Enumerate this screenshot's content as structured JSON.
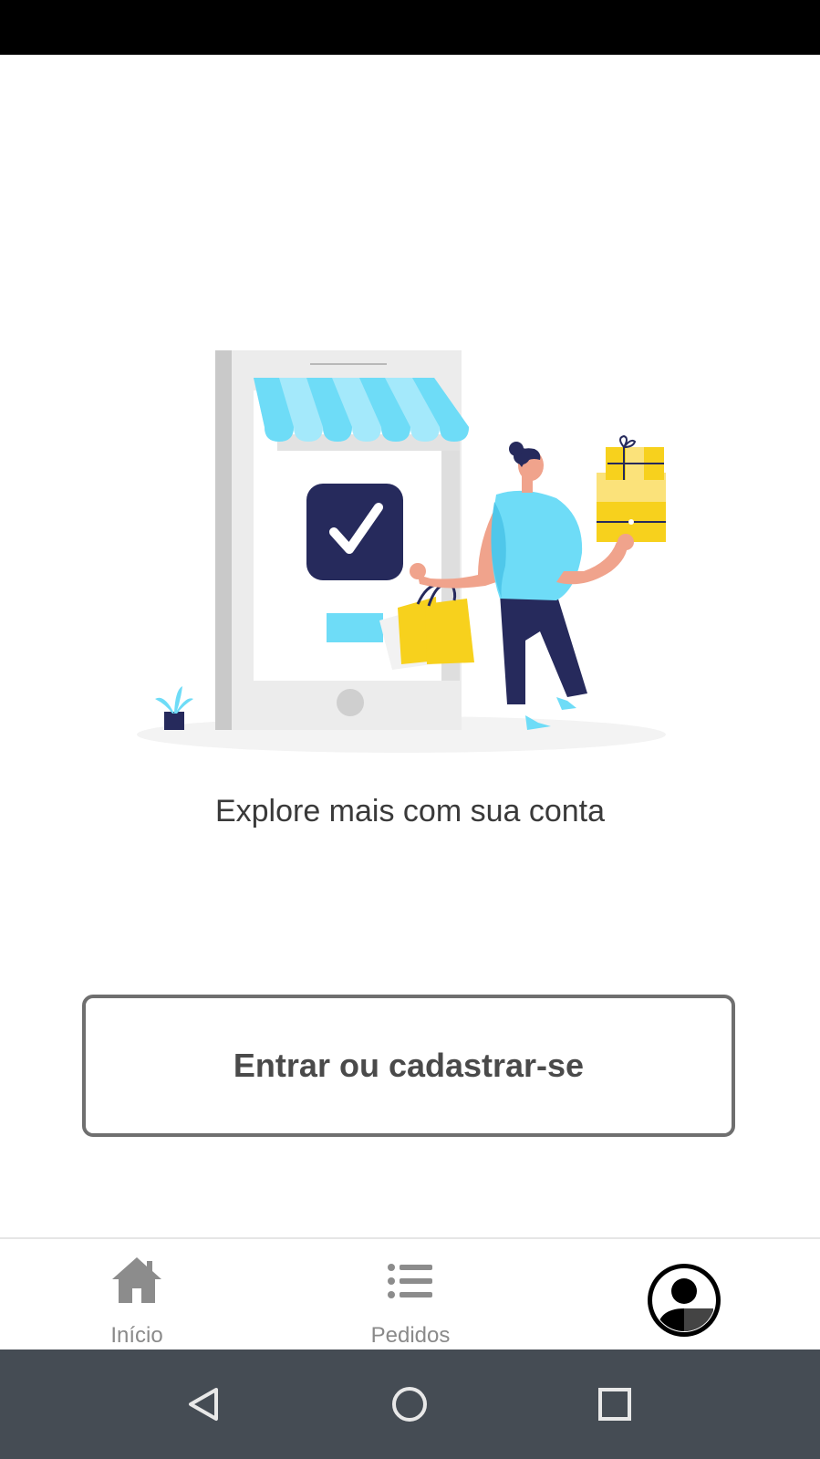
{
  "empty_state": {
    "message": "Explore mais com sua conta",
    "illustration_icon": "shopping-illustration"
  },
  "login": {
    "button_label": "Entrar ou cadastrar-se"
  },
  "tab_bar": {
    "items": [
      {
        "label": "Início",
        "icon": "home-icon",
        "active": false
      },
      {
        "label": "Pedidos",
        "icon": "list-icon",
        "active": false
      },
      {
        "label": "",
        "icon": "account-icon",
        "active": true
      }
    ]
  },
  "system_nav": {
    "buttons": [
      "back-icon",
      "home-circle-icon",
      "recents-icon"
    ]
  },
  "colors": {
    "accent_blue": "#6edcf7",
    "navy": "#262a5c",
    "yellow": "#f7d11d",
    "skin": "#f0a38c",
    "button_border": "#6f6f6f",
    "nav_bar": "#454c54"
  }
}
